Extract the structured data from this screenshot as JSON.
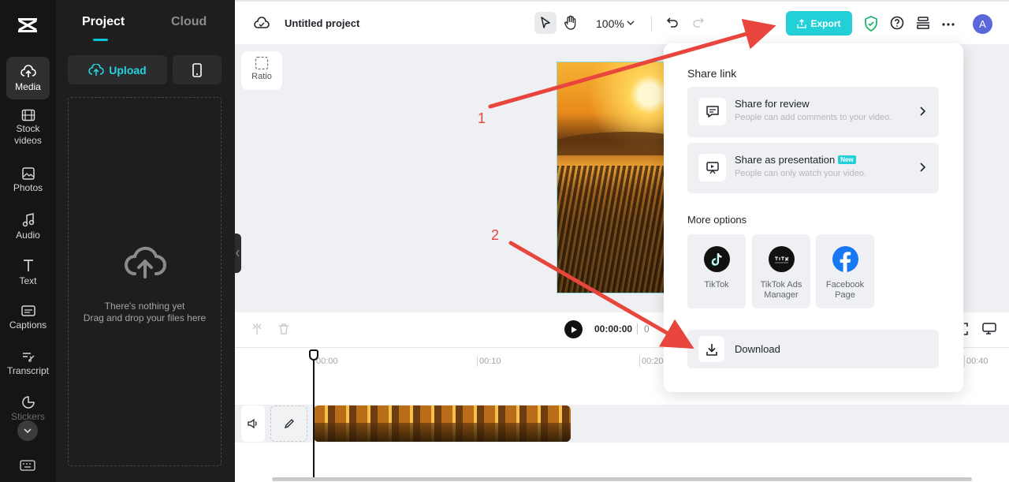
{
  "rail": {
    "items": [
      {
        "label": "Media"
      },
      {
        "label": "Stock videos"
      },
      {
        "label": "Photos"
      },
      {
        "label": "Audio"
      },
      {
        "label": "Text"
      },
      {
        "label": "Captions"
      },
      {
        "label": "Transcript"
      },
      {
        "label": "Stickers"
      }
    ]
  },
  "panel": {
    "tab_project": "Project",
    "tab_cloud": "Cloud",
    "upload_label": "Upload",
    "empty_title": "There's nothing yet",
    "empty_hint": "Drag and drop your files here"
  },
  "topbar": {
    "title": "Untitled project",
    "zoom": "100%",
    "export_label": "Export",
    "avatar_letter": "A"
  },
  "canvas": {
    "ratio_label": "Ratio"
  },
  "timeline": {
    "timecode": "00:00:00",
    "duration_partial": "0",
    "ticks": [
      "00:00",
      "00:10",
      "00:20",
      "00:40"
    ]
  },
  "export_popup": {
    "share_heading": "Share link",
    "share_review_title": "Share for review",
    "share_review_sub": "People can add comments to your video.",
    "share_presentation_title": "Share as presentation",
    "share_presentation_badge": "New",
    "share_presentation_sub": "People can only watch your video.",
    "more_heading": "More options",
    "options": [
      {
        "label": "TikTok",
        "icon": "tiktok-icon"
      },
      {
        "label": "TikTok Ads Manager",
        "icon": "tiktok-ads-icon"
      },
      {
        "label": "Facebook Page",
        "icon": "facebook-icon"
      }
    ],
    "download_label": "Download"
  },
  "annotations": {
    "step1": "1",
    "step2": "2",
    "color": "#e8453c"
  },
  "colors": {
    "accent": "#23d0d8",
    "rail_bg": "#151515",
    "panel_bg": "#1e1e1f"
  }
}
